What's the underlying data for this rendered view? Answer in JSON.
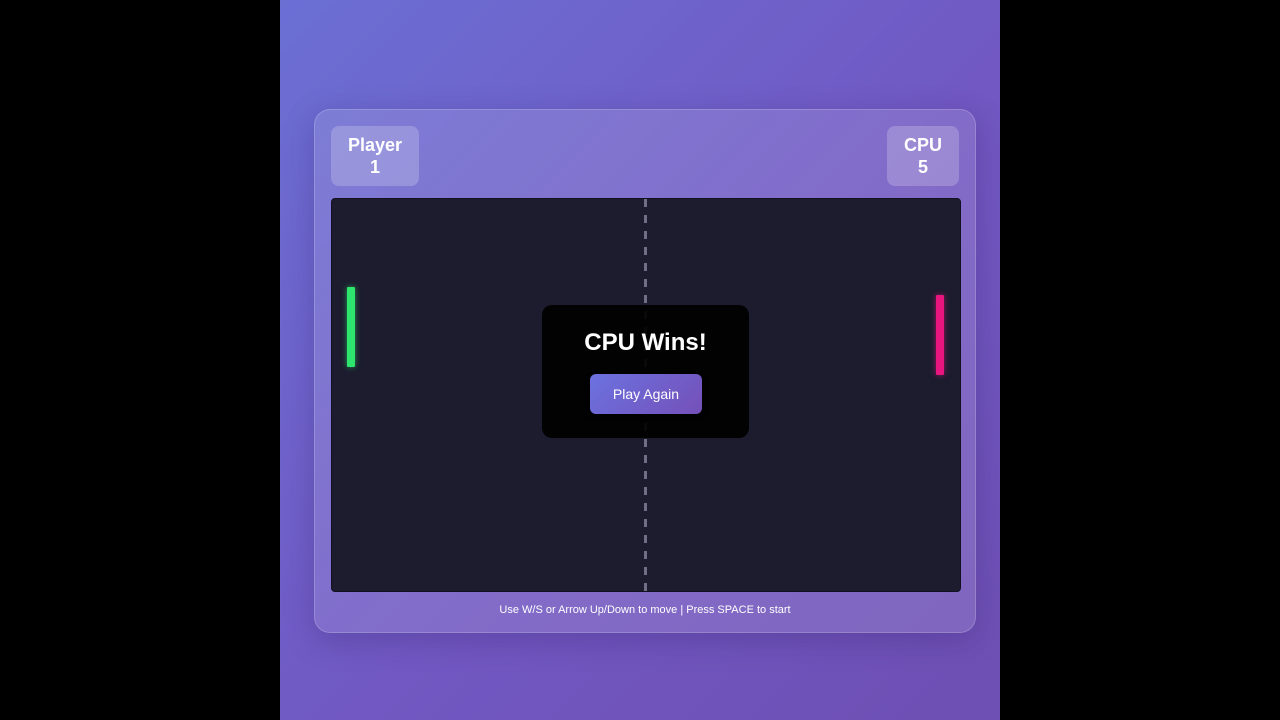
{
  "scoreboard": {
    "player": {
      "label": "Player",
      "score": "1",
      "color": "#2ee56e"
    },
    "cpu": {
      "label": "CPU",
      "score": "5",
      "color": "#e8157e"
    }
  },
  "game_over": {
    "title": "CPU Wins!",
    "button_label": "Play Again"
  },
  "instructions": "Use W/S or Arrow Up/Down to move | Press SPACE to start",
  "colors": {
    "field_bg": "#1c1c2e",
    "background_gradient": [
      "#6b6fd4",
      "#6e4fb3"
    ],
    "center_line": "#6e6e86"
  }
}
